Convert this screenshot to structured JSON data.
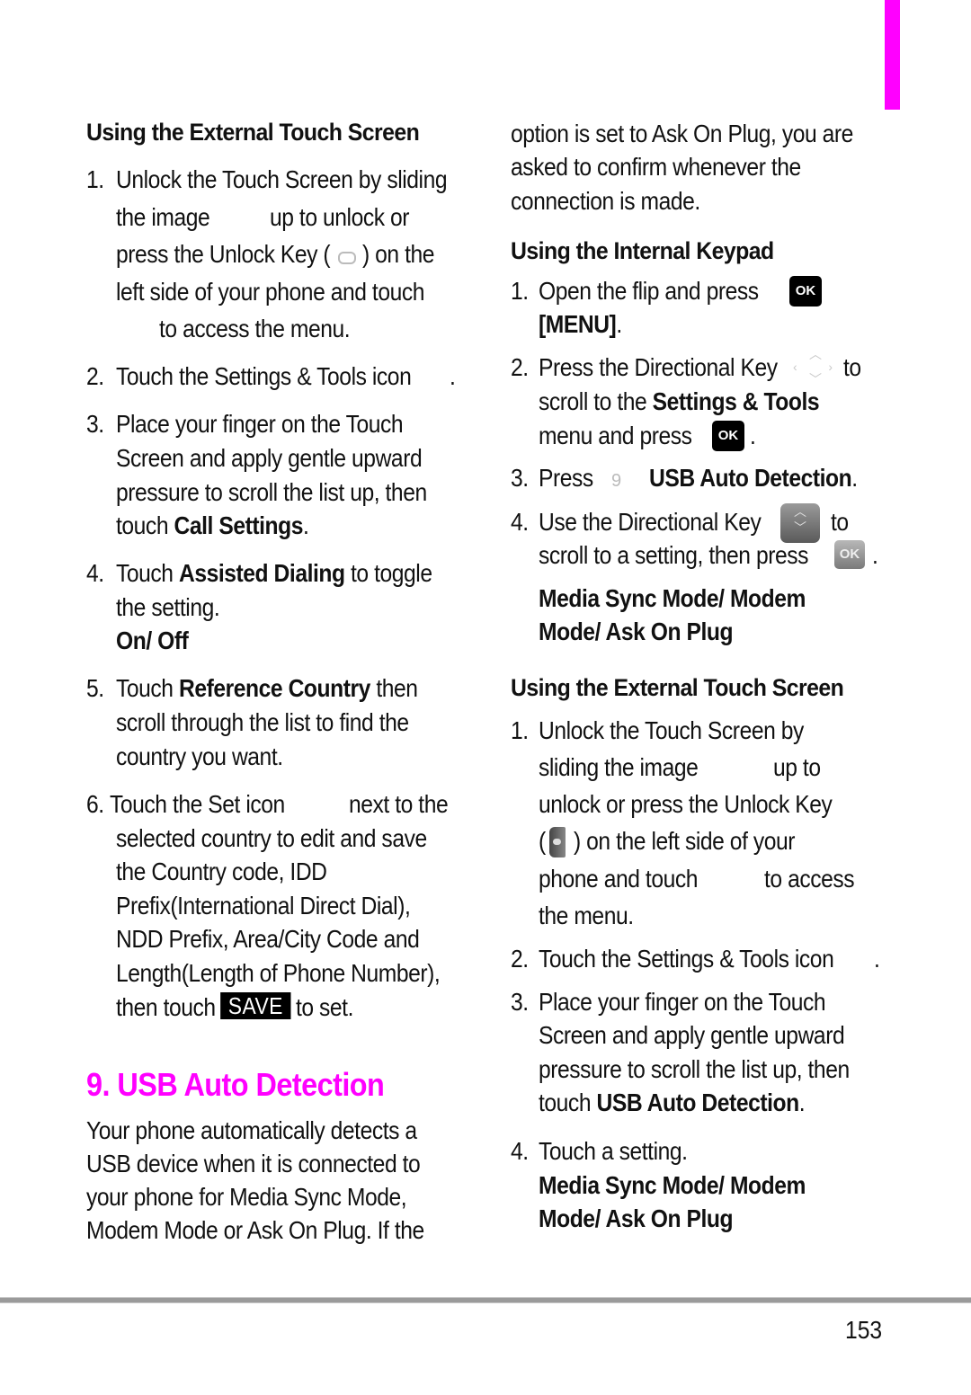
{
  "accent_color": "#ff00ff",
  "left": {
    "ext_heading": "Using the External Touch Screen",
    "step1": {
      "num": "1.",
      "l1": "Unlock the Touch Screen by sliding",
      "l2a": "the image",
      "l2b": "up to unlock or",
      "l3a": "press the Unlock Key (",
      "l3b": ") on the",
      "l4": "left side of your phone and touch",
      "l5": "to access the menu."
    },
    "step2": {
      "num": "2.",
      "text": "Touch the Settings & Tools icon",
      "end": "."
    },
    "step3": {
      "num": "3.",
      "l1": "Place your finger on the Touch",
      "l2": "Screen and apply gentle upward",
      "l3": "pressure to scroll the list up, then",
      "l4a": "touch",
      "l4b": "Call Settings",
      "l4c": "."
    },
    "step4": {
      "num": "4.",
      "l1a": "Touch",
      "l1b": "Assisted Dialing",
      "l1c": "to toggle",
      "l2": "the setting.",
      "options": "On/ Off"
    },
    "step5": {
      "num": "5.",
      "l1a": "Touch",
      "l1b": "Reference Country",
      "l1c": "then",
      "l2": "scroll through the list to find the",
      "l3": "country you want."
    },
    "step6": {
      "num": "6.",
      "l1a": "Touch the Set icon",
      "l1b": "next to the",
      "l2": "selected country to edit and save",
      "l3": "the Country code, IDD",
      "l4": "Prefix(International Direct Dial),",
      "l5": "NDD Prefix, Area/City Code and",
      "l6": "Length(Length of Phone Number),",
      "l7a": "then touch",
      "save_key": "SAVE",
      "l7b": "to set."
    },
    "section_title": "9. USB Auto Detection",
    "intro": [
      "Your phone automatically detects a",
      "USB device when it is connected to",
      "your phone for Media Sync Mode,",
      "Modem Mode or Ask On Plug. If the"
    ]
  },
  "right": {
    "intro_cont": [
      "option is set to Ask On Plug, you are",
      "asked to confirm whenever the",
      "connection is made."
    ],
    "int_heading": "Using the Internal Keypad",
    "k1": {
      "num": "1.",
      "text": "Open the flip and press",
      "ok": "OK",
      "menu": "[MENU]",
      "end": "."
    },
    "k2": {
      "num": "2.",
      "l1a": "Press the Directional Key",
      "l1b": "to",
      "l2a": "scroll to the",
      "l2b": "Settings & Tools",
      "l3": "menu and press",
      "ok": "OK",
      "end": "."
    },
    "k3": {
      "num": "3.",
      "text": "Press",
      "icon_label": "9",
      "bold": "USB Auto Detection",
      "end": "."
    },
    "k4": {
      "num": "4.",
      "l1a": "Use the Directional Key",
      "l1b": "to",
      "l2": "scroll to a setting, then press",
      "ok": "OK",
      "end": ".",
      "opt1": "Media Sync Mode/ Modem",
      "opt2": "Mode/ Ask On Plug"
    },
    "ext_heading": "Using the External Touch Screen",
    "e1": {
      "num": "1.",
      "l1": "Unlock the Touch Screen by",
      "l2a": "sliding the image",
      "l2b": "up to",
      "l3": "unlock or press the Unlock Key",
      "l4a": "(",
      "l4b": ") on the left side of your",
      "l5a": "phone and touch",
      "l5b": "to access",
      "l6": "the menu."
    },
    "e2": {
      "num": "2.",
      "text": "Touch the Settings & Tools icon",
      "end": "."
    },
    "e3": {
      "num": "3.",
      "l1": "Place your finger on the Touch",
      "l2": "Screen and apply gentle upward",
      "l3": "pressure to scroll the list up, then",
      "l4a": "touch",
      "l4b": "USB Auto Detection",
      "l4c": "."
    },
    "e4": {
      "num": "4.",
      "text": "Touch a setting.",
      "opt1": "Media Sync Mode/ Modem",
      "opt2": "Mode/ Ask On Plug"
    }
  },
  "footer": {
    "page_number": "153"
  }
}
